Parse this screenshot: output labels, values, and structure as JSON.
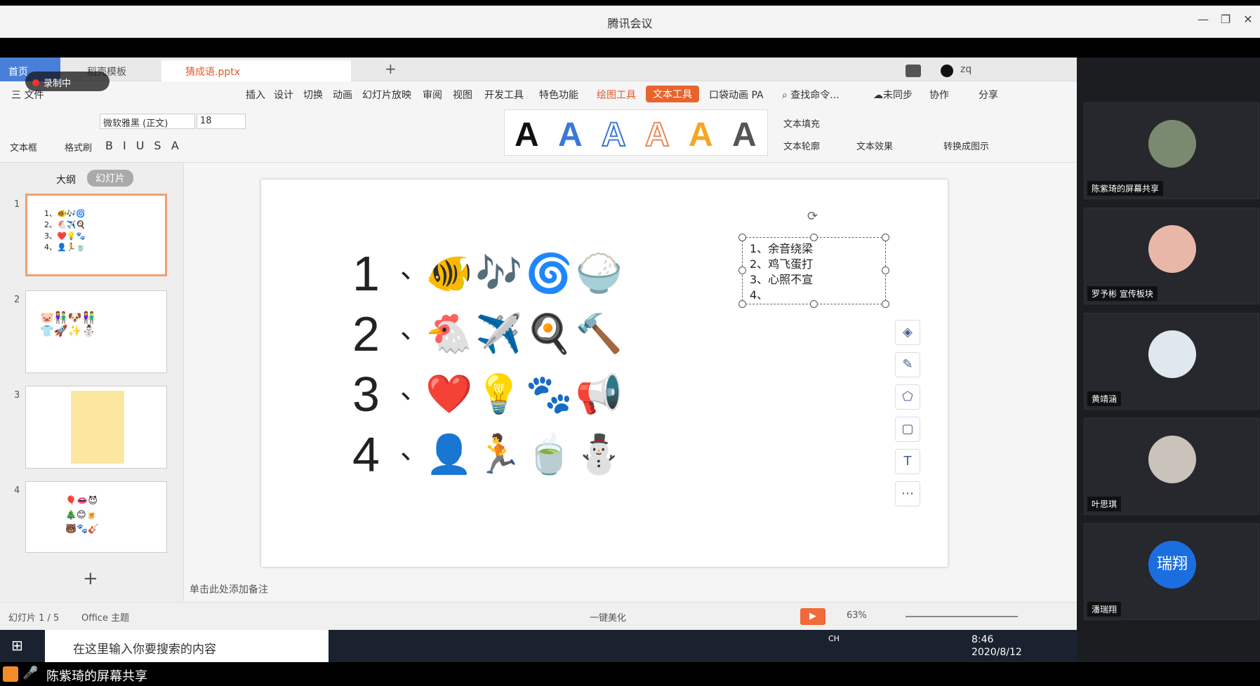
{
  "window": {
    "title": "腾讯会议",
    "controls": [
      "—",
      "❐",
      "✕"
    ]
  },
  "recording": {
    "label": "录制中"
  },
  "tabs": [
    {
      "label": "首页"
    },
    {
      "label": "稻壳模板"
    },
    {
      "label": "猜成语.pptx"
    }
  ],
  "menu": {
    "file": "三 文件",
    "items": [
      "插入",
      "设计",
      "切换",
      "动画",
      "幻灯片放映",
      "审阅",
      "视图",
      "开发工具",
      "特色功能"
    ],
    "drawing_tools": "绘图工具",
    "text_tools": "文本工具",
    "pocket": "口袋动画 PA",
    "search": "查找命令...",
    "sync": "未同步",
    "collab": "协作",
    "share": "分享"
  },
  "ribbon": {
    "textbox": "文本框",
    "format_painter": "格式刷",
    "font": "微软雅黑 (正文)",
    "size": "18",
    "text_fill": "文本填充",
    "text_outline": "文本轮廓",
    "text_effect": "文本效果",
    "convert": "转换成图示",
    "style_letter": "A"
  },
  "panel": {
    "outline": "大纲",
    "slides": "幻灯片",
    "numbers": [
      "1",
      "2",
      "3",
      "4"
    ],
    "add": "+"
  },
  "slide": {
    "rows": [
      {
        "num": "1",
        "sep": "、",
        "emoji": "🐠🎶🌀🍚"
      },
      {
        "num": "2",
        "sep": "、",
        "emoji": "🐔✈️🍳🔨"
      },
      {
        "num": "3",
        "sep": "、",
        "emoji": "❤️💡🐾📢"
      },
      {
        "num": "4",
        "sep": "、",
        "emoji": "👤🏃🍵⛄"
      }
    ],
    "textbox": [
      "1、余音绕梁",
      "2、鸡飞蛋打",
      "3、心照不宣",
      "4、"
    ]
  },
  "notes": "单击此处添加备注",
  "status": {
    "slide": "幻灯片 1 / 5",
    "theme": "Office 主题",
    "beautify": "一键美化",
    "zoom": "63%"
  },
  "taskbar": {
    "search": "在这里输入你要搜索的内容",
    "time": "8:46",
    "date": "2020/8/12",
    "lang": "CH"
  },
  "footer": {
    "text": "陈紫琦的屏幕共享"
  },
  "participants": [
    {
      "name": "陈紫琦的屏幕共享"
    },
    {
      "name": "罗予彬 宣传板块"
    },
    {
      "name": "黄靖涵"
    },
    {
      "name": "叶思琪"
    },
    {
      "name": "潘瑞翔",
      "avatar": "瑞翔"
    }
  ],
  "user": {
    "name": "zq"
  },
  "colors": {
    "accent": "#e8642e",
    "blue": "#4a7fd9"
  }
}
